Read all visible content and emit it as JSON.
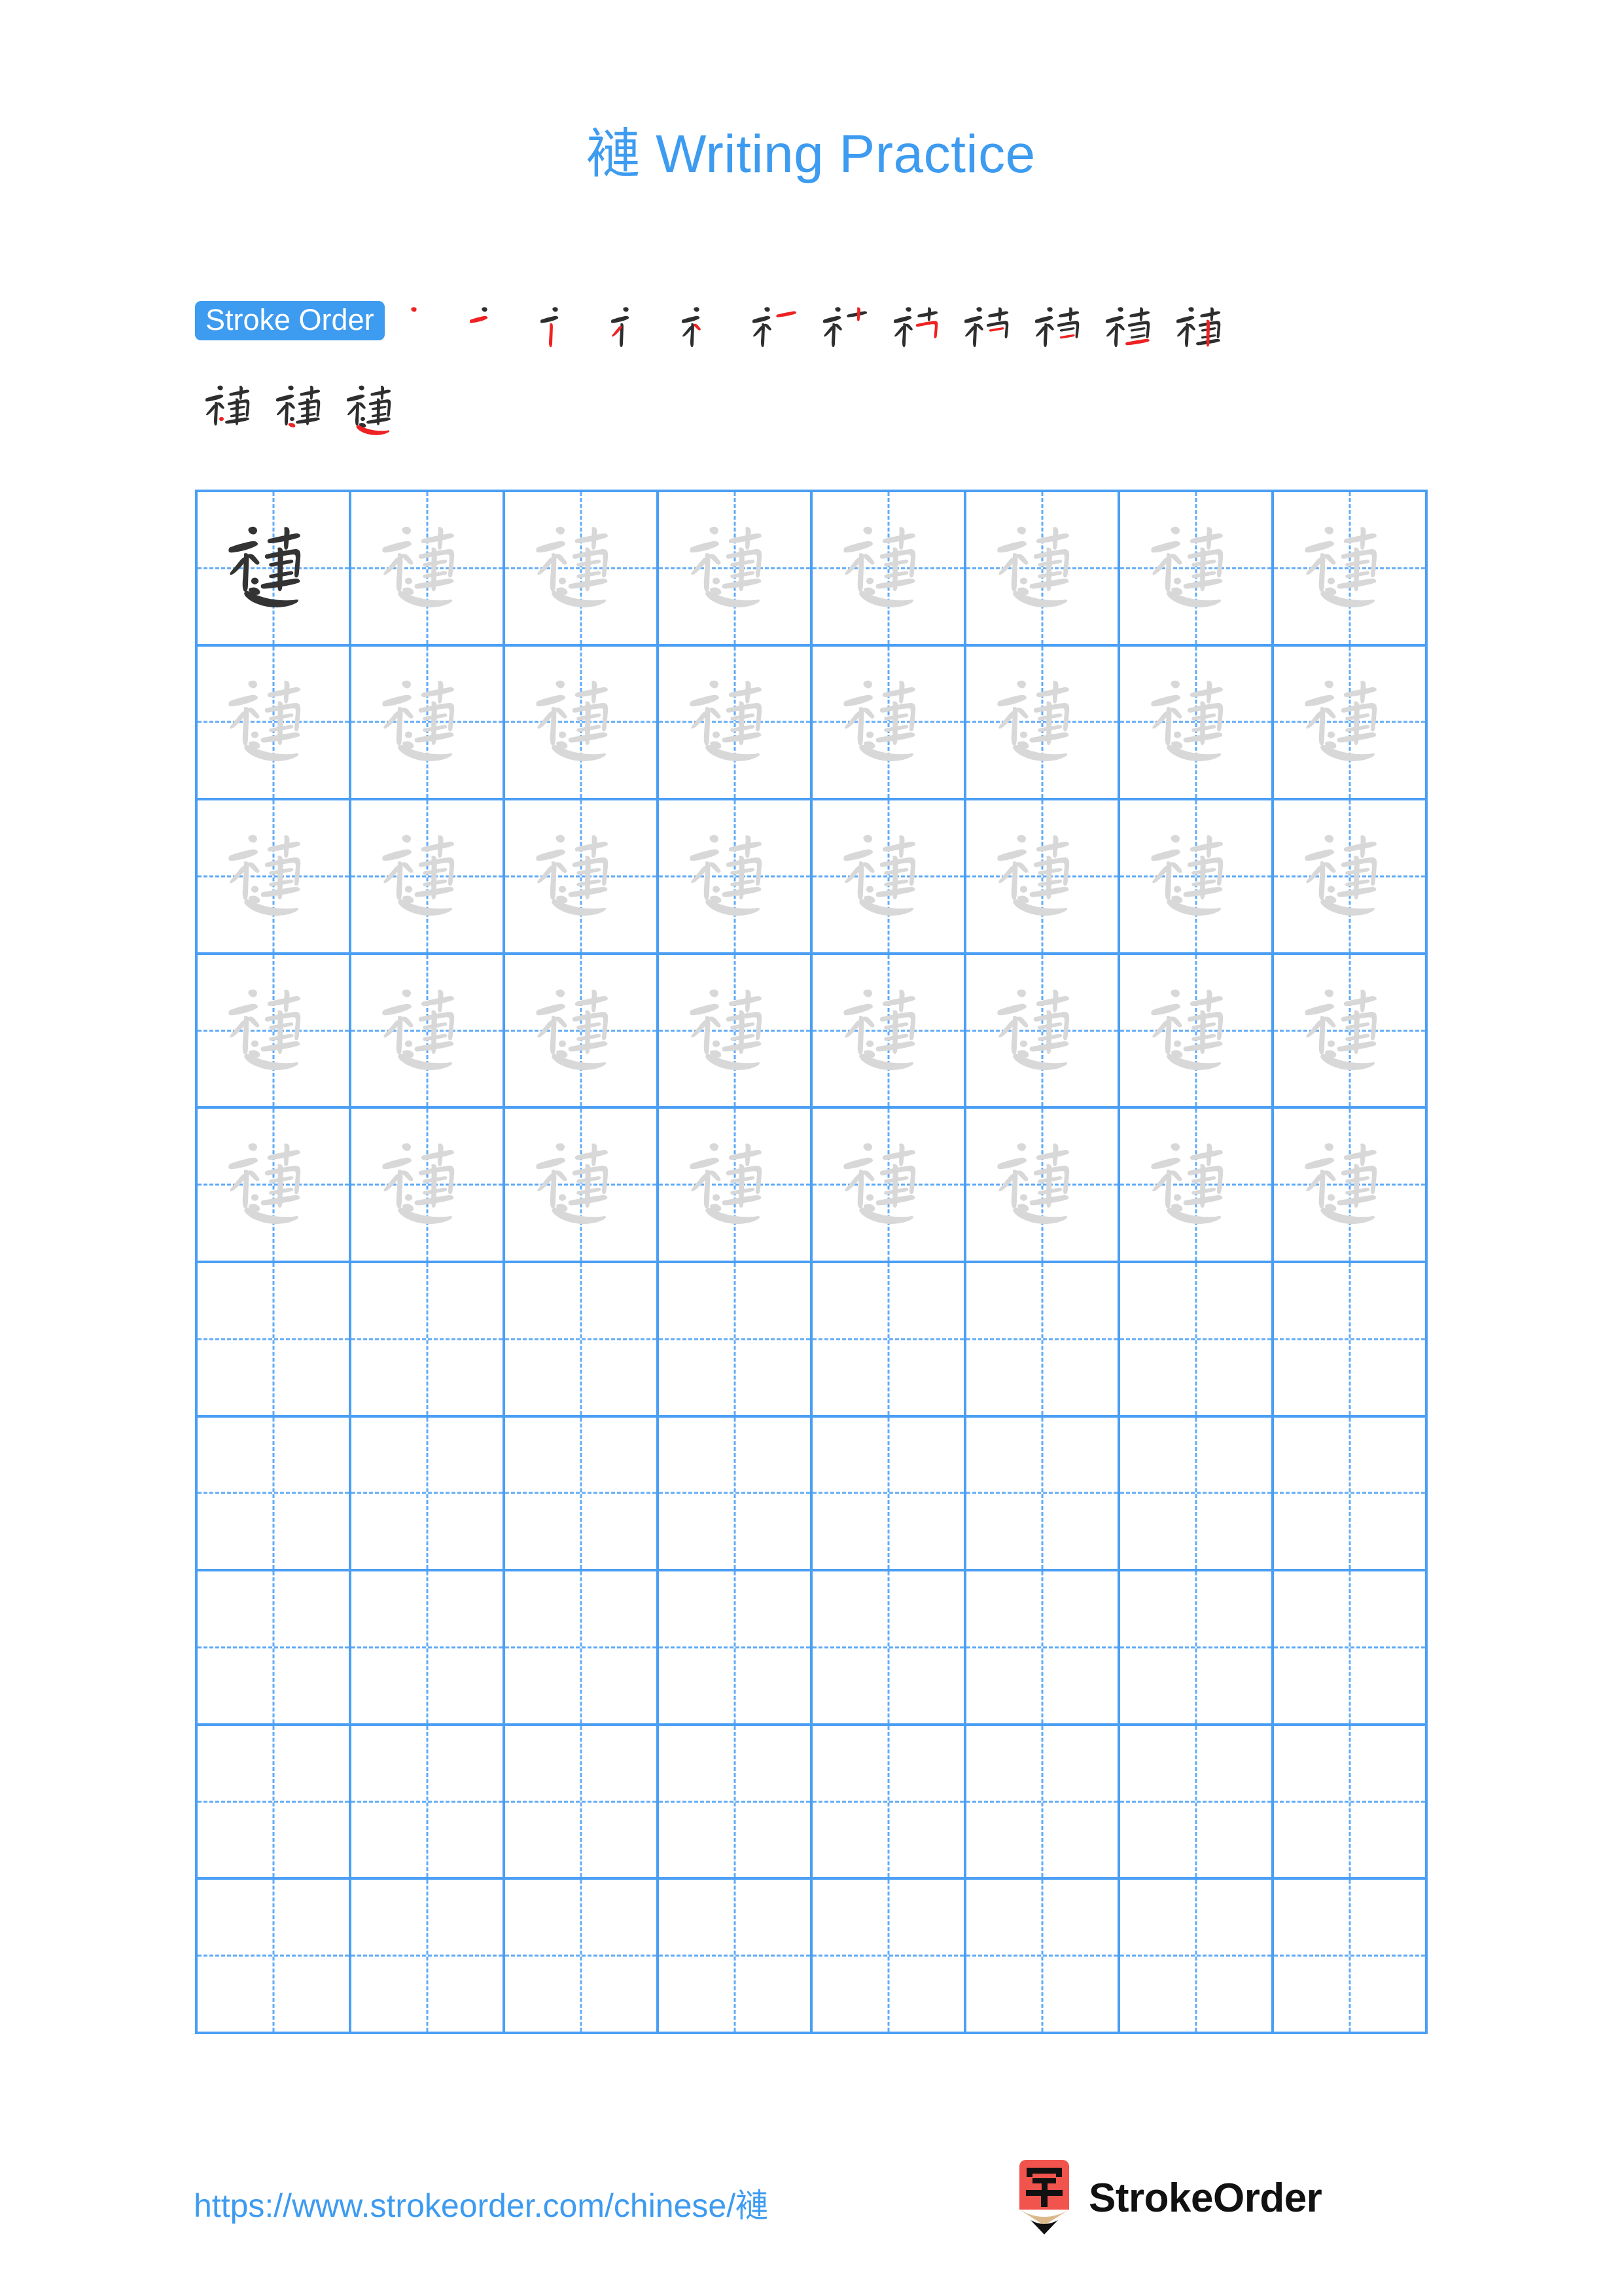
{
  "page": {
    "character": "褳",
    "title_text": "褳 Writing Practice",
    "title_suffix": "Writing Practice",
    "background_color": "#ffffff",
    "accent_color": "#3d9bf0",
    "grid_line_color": "#4a9ff5",
    "grid_guide_color": "#61abf7",
    "model_char_color": "#333333",
    "trace_char_color": "#d8d8d8",
    "new_stroke_color": "#ee2222",
    "done_stroke_color": "#2e2e2e"
  },
  "stroke_order": {
    "badge_label": "Stroke Order",
    "total_strokes": 15,
    "row_1_count": 12,
    "row_2_count": 3,
    "steps": [
      {
        "index": 1,
        "new_stroke": "dot (丶)"
      },
      {
        "index": 2,
        "new_stroke": "horizontal-fold (𠃍)"
      },
      {
        "index": 3,
        "new_stroke": "vertical (丨)"
      },
      {
        "index": 4,
        "new_stroke": "dot (丶)"
      },
      {
        "index": 5,
        "new_stroke": "left-falling (丿)"
      },
      {
        "index": 6,
        "new_stroke": "horizontal (一)"
      },
      {
        "index": 7,
        "new_stroke": "vertical (丨)"
      },
      {
        "index": 8,
        "new_stroke": "horizontal-fold (𠃍)"
      },
      {
        "index": 9,
        "new_stroke": "horizontal (一)"
      },
      {
        "index": 10,
        "new_stroke": "horizontal (一)"
      },
      {
        "index": 11,
        "new_stroke": "horizontal (一)"
      },
      {
        "index": 12,
        "new_stroke": "vertical (丨)"
      },
      {
        "index": 13,
        "new_stroke": "dot (丶)"
      },
      {
        "index": 14,
        "new_stroke": "falling-dot (㇏)"
      },
      {
        "index": 15,
        "new_stroke": "horizontal-press (㇏)"
      }
    ]
  },
  "practice_grid": {
    "columns": 8,
    "rows": 10,
    "model_cells": 1,
    "trace_cells": 39,
    "empty_cells": 40,
    "cell_contents": [
      [
        "model",
        "trace",
        "trace",
        "trace",
        "trace",
        "trace",
        "trace",
        "trace"
      ],
      [
        "trace",
        "trace",
        "trace",
        "trace",
        "trace",
        "trace",
        "trace",
        "trace"
      ],
      [
        "trace",
        "trace",
        "trace",
        "trace",
        "trace",
        "trace",
        "trace",
        "trace"
      ],
      [
        "trace",
        "trace",
        "trace",
        "trace",
        "trace",
        "trace",
        "trace",
        "trace"
      ],
      [
        "trace",
        "trace",
        "trace",
        "trace",
        "trace",
        "trace",
        "trace",
        "trace"
      ],
      [
        "empty",
        "empty",
        "empty",
        "empty",
        "empty",
        "empty",
        "empty",
        "empty"
      ],
      [
        "empty",
        "empty",
        "empty",
        "empty",
        "empty",
        "empty",
        "empty",
        "empty"
      ],
      [
        "empty",
        "empty",
        "empty",
        "empty",
        "empty",
        "empty",
        "empty",
        "empty"
      ],
      [
        "empty",
        "empty",
        "empty",
        "empty",
        "empty",
        "empty",
        "empty",
        "empty"
      ],
      [
        "empty",
        "empty",
        "empty",
        "empty",
        "empty",
        "empty",
        "empty",
        "empty"
      ]
    ]
  },
  "footer": {
    "url": "https://www.strokeorder.com/chinese/褳",
    "brand_name": "StrokeOrder",
    "logo_char": "字",
    "logo_body_color": "#f0544c",
    "logo_wood_color": "#dbb98b",
    "logo_tip_color": "#111111"
  }
}
